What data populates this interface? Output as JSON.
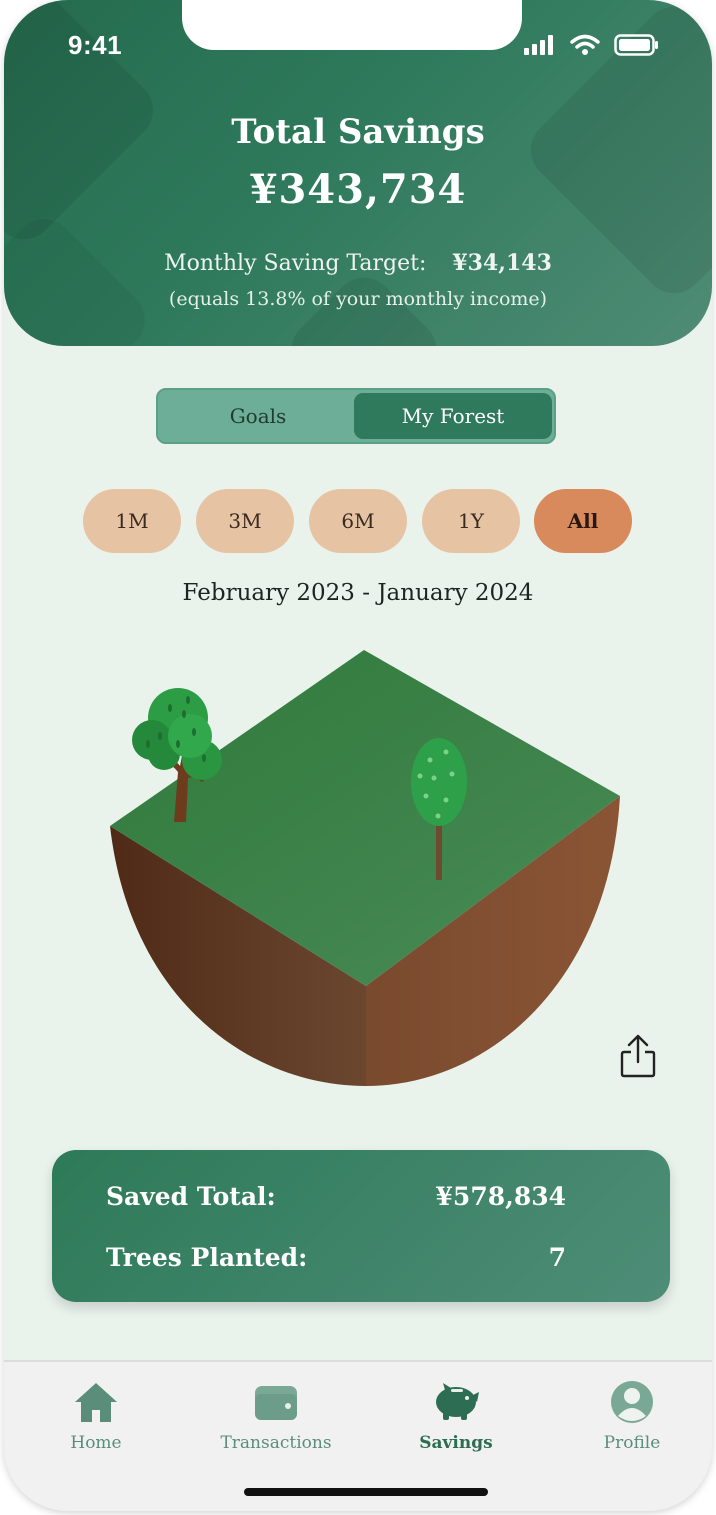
{
  "status_bar": {
    "time": "9:41"
  },
  "header": {
    "title": "Total Savings",
    "total": "¥343,734",
    "target_label": "Monthly Saving Target:",
    "target_amount": "¥34,143",
    "income_note": "(equals 13.8% of your monthly income)"
  },
  "segments": {
    "goals": "Goals",
    "forest": "My Forest",
    "selected": "My Forest"
  },
  "ranges": {
    "items": [
      "1M",
      "3M",
      "6M",
      "1Y",
      "All"
    ],
    "selected": "All"
  },
  "period": "February 2023 - January 2024",
  "summary": {
    "saved_label": "Saved Total:",
    "saved_value": "¥578,834",
    "trees_label": "Trees Planted:",
    "trees_value": "7"
  },
  "tabbar": {
    "items": [
      {
        "label": "Home",
        "icon": "house-icon"
      },
      {
        "label": "Transactions",
        "icon": "wallet-icon"
      },
      {
        "label": "Savings",
        "icon": "piggy-bank-icon"
      },
      {
        "label": "Profile",
        "icon": "user-icon"
      }
    ],
    "selected": "Savings"
  },
  "colors": {
    "primary_green": "#2f7a5c",
    "pill_inactive": "#e6c3a3",
    "pill_active": "#d98a5c",
    "background": "#eaf2ec"
  }
}
